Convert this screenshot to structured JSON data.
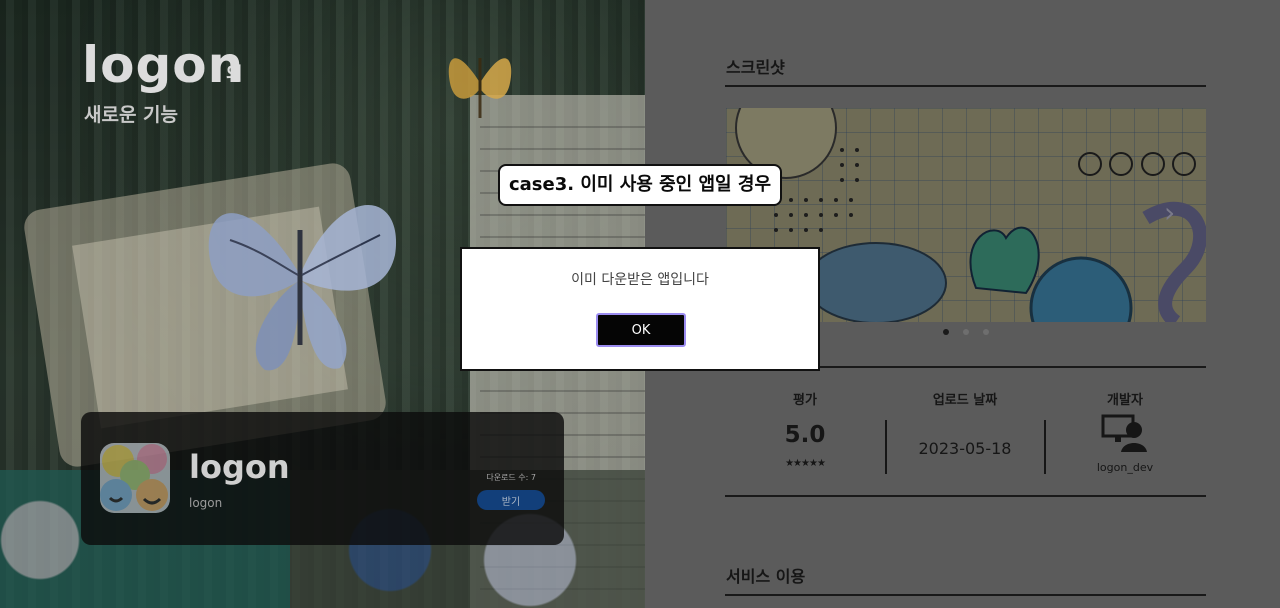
{
  "hero": {
    "logo": "logon",
    "logo_suffix": "의",
    "subtitle": "새로운 기능"
  },
  "app_card": {
    "name": "logon",
    "developer": "logon",
    "download_count": "다운로드 수: 7",
    "get_button": "받기"
  },
  "screenshots": {
    "title": "스크린샷",
    "total_slides": 3,
    "active_slide": 1
  },
  "info": {
    "rating_label": "평가",
    "rating_value": "5.0",
    "stars": "★★★★★",
    "upload_label": "업로드 날짜",
    "upload_date": "2023-05-18",
    "developer_label": "개발자",
    "developer_name": "logon_dev"
  },
  "service": {
    "title": "서비스 이용"
  },
  "overlay": {
    "case_label": "case3. 이미 사용 중인 앱일 경우",
    "message": "이미 다운받은 앱입니다",
    "ok_button": "OK"
  },
  "colors": {
    "dimmed_background": "#5b5b5b",
    "dialog_border": "#111111",
    "ok_button_bg": "#050505",
    "ok_button_focus": "#9b8cf0",
    "get_button_bg": "#123f7a"
  }
}
